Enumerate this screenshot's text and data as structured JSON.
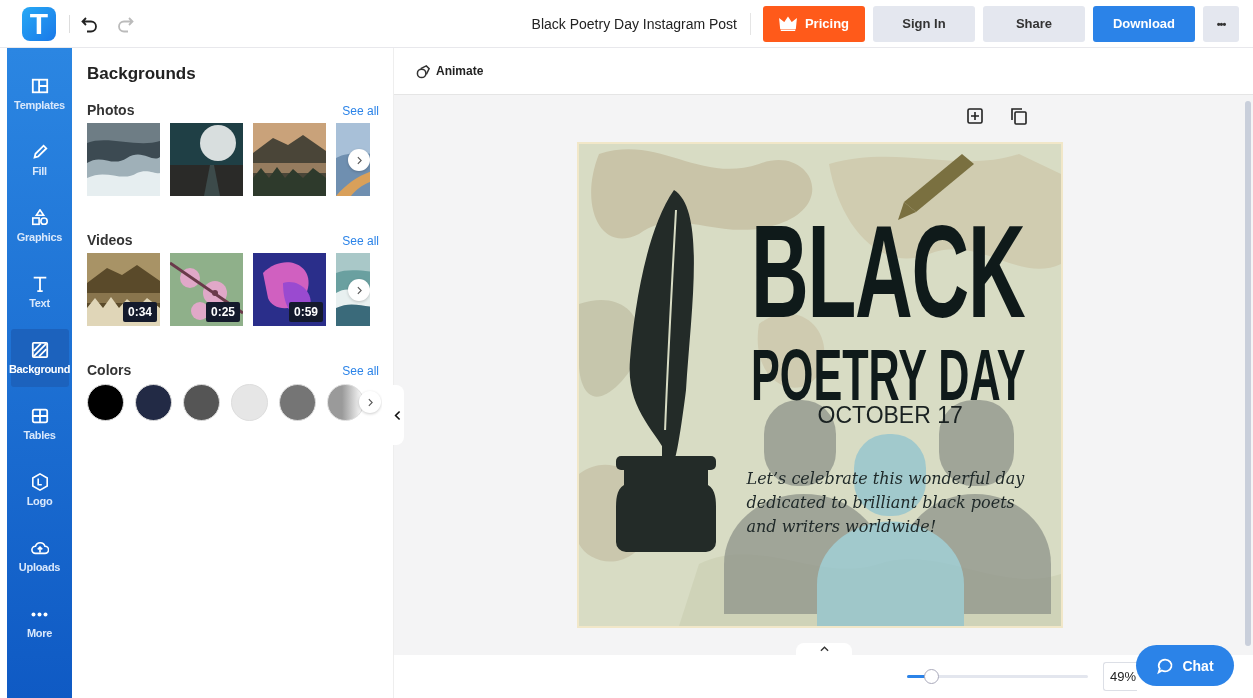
{
  "app": {
    "logo": "T"
  },
  "header": {
    "document_title": "Black Poetry Day Instagram Post",
    "buttons": [
      {
        "kind": "pricing",
        "label": "Pricing"
      },
      {
        "kind": "plain",
        "label": "Sign In"
      },
      {
        "kind": "plain",
        "label": "Share"
      },
      {
        "kind": "primary",
        "label": "Download"
      },
      {
        "kind": "more",
        "label": "•••"
      }
    ]
  },
  "sidebar": {
    "items": [
      {
        "label": "Templates",
        "selected": false
      },
      {
        "label": "Fill",
        "selected": false
      },
      {
        "label": "Graphics",
        "selected": false
      },
      {
        "label": "Text",
        "selected": false
      },
      {
        "label": "Background",
        "selected": true
      },
      {
        "label": "Tables",
        "selected": false
      },
      {
        "label": "Logo",
        "selected": false
      },
      {
        "label": "Uploads",
        "selected": false
      },
      {
        "label": "More",
        "selected": false
      }
    ]
  },
  "panel": {
    "title": "Backgrounds",
    "photos": {
      "heading": "Photos",
      "see_all": "See all"
    },
    "videos": {
      "heading": "Videos",
      "see_all": "See all",
      "items": [
        {
          "duration": "0:34"
        },
        {
          "duration": "0:25"
        },
        {
          "duration": "0:59"
        }
      ]
    },
    "colors": {
      "heading": "Colors",
      "see_all": "See all",
      "items": [
        {
          "kind": "solid",
          "color": "#000000"
        },
        {
          "kind": "solid",
          "color": "#222a45"
        },
        {
          "kind": "solid",
          "color": "#555555"
        },
        {
          "kind": "solid",
          "color": "#e6e6e6"
        },
        {
          "kind": "solid",
          "color": "#757575"
        },
        {
          "kind": "gradient",
          "color": "#9a9a9a"
        }
      ]
    }
  },
  "toolbar": {
    "animate": "Animate"
  },
  "design": {
    "title": "BLACK",
    "subtitle": "POETRY DAY",
    "date": "OCTOBER 17",
    "tagline": "Let’s celebrate this wonderful day dedicated to brilliant black poets and writers worldwide!"
  },
  "zoom": {
    "level": 0.14,
    "value": "49%"
  },
  "chat": {
    "label": "Chat"
  }
}
